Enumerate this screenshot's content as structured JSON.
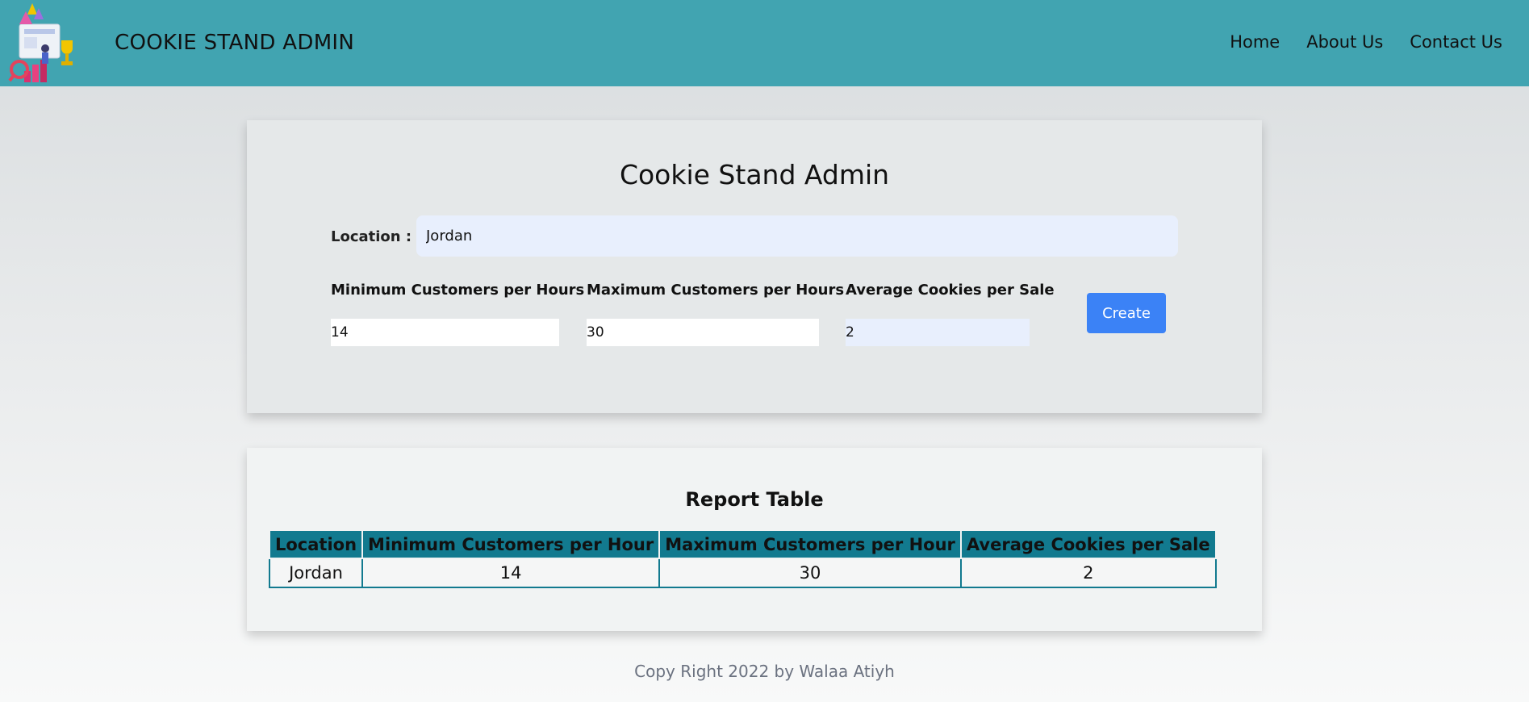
{
  "header": {
    "brand": "COOKIE STAND ADMIN",
    "nav": [
      "Home",
      "About Us",
      "Contact Us"
    ]
  },
  "form": {
    "title": "Cookie Stand Admin",
    "location_label": "Location :",
    "location_value": "Jordan",
    "min_label": "Minimum Customers per Hours",
    "min_value": "14",
    "max_label": "Maximum Customers per Hours",
    "max_value": "30",
    "avg_label": "Average Cookies per Sale",
    "avg_value": "2",
    "create_label": "Create"
  },
  "report": {
    "title": "Report Table",
    "headers": [
      "Location",
      "Minimum Customers per Hour",
      "Maximum Customers per Hour",
      "Average Cookies per Sale"
    ],
    "rows": [
      [
        "Jordan",
        "14",
        "30",
        "2"
      ]
    ]
  },
  "footer": {
    "text": "Copy Right 2022 by Walaa Atiyh"
  },
  "colors": {
    "header_bg": "#41a4b1",
    "table_header_bg": "#127a8f",
    "button_bg": "#3b82f6",
    "input_highlight": "#e8effd"
  },
  "icons": {
    "logo": "analytics-dashboard-logo"
  }
}
